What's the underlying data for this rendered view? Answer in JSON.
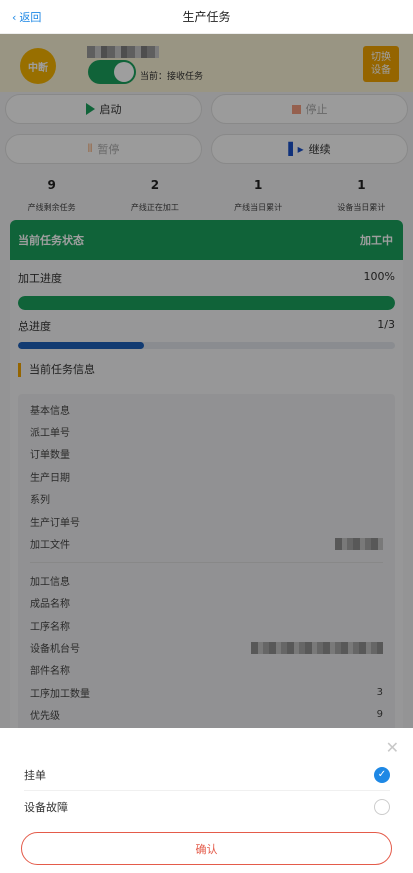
{
  "header": {
    "back_label": "返回",
    "title": "生产任务"
  },
  "user": {
    "avatar_text": "中断",
    "mode_text": "当前：接收任务",
    "receive_toggle_on": true,
    "switch_button_line1": "切换",
    "switch_button_line2": "设备"
  },
  "actions": {
    "start": "启动",
    "stop": "停止",
    "pause": "暂停",
    "resume": "继续"
  },
  "stats": [
    {
      "value": "9",
      "label": "产线剩余任务"
    },
    {
      "value": "2",
      "label": "产线正在加工"
    },
    {
      "value": "1",
      "label": "产线当日累计"
    },
    {
      "value": "1",
      "label": "设备当日累计"
    }
  ],
  "task_status": {
    "title": "当前任务状态",
    "status": "加工中",
    "processing_progress": {
      "label": "加工进度",
      "value": "100%",
      "fraction": 1.0,
      "color": "#1aa05c"
    },
    "total_progress": {
      "label": "总进度",
      "value": "1/3",
      "fraction": 0.333,
      "color": "#1e60b8"
    }
  },
  "task_info": {
    "title": "当前任务信息",
    "basic": [
      "基本信息",
      "派工单号",
      "订单数量",
      "生产日期",
      "系列",
      "生产订单号"
    ],
    "file_label": "加工文件",
    "process": [
      "加工信息",
      "成品名称",
      "工序名称"
    ],
    "machine_label": "设备机台号",
    "part_label": "部件名称",
    "qty_label": "工序加工数量",
    "qty_value": "3",
    "priority_label": "优先级",
    "priority_value": "9"
  },
  "sheet": {
    "options": [
      {
        "label": "挂单",
        "selected": true
      },
      {
        "label": "设备故障",
        "selected": false
      }
    ],
    "confirm": "确认"
  },
  "colors": {
    "accent_green": "#1aa05c",
    "accent_orange": "#f0a400",
    "accent_blue": "#1e88e5",
    "confirm_red": "#e45b4a"
  }
}
